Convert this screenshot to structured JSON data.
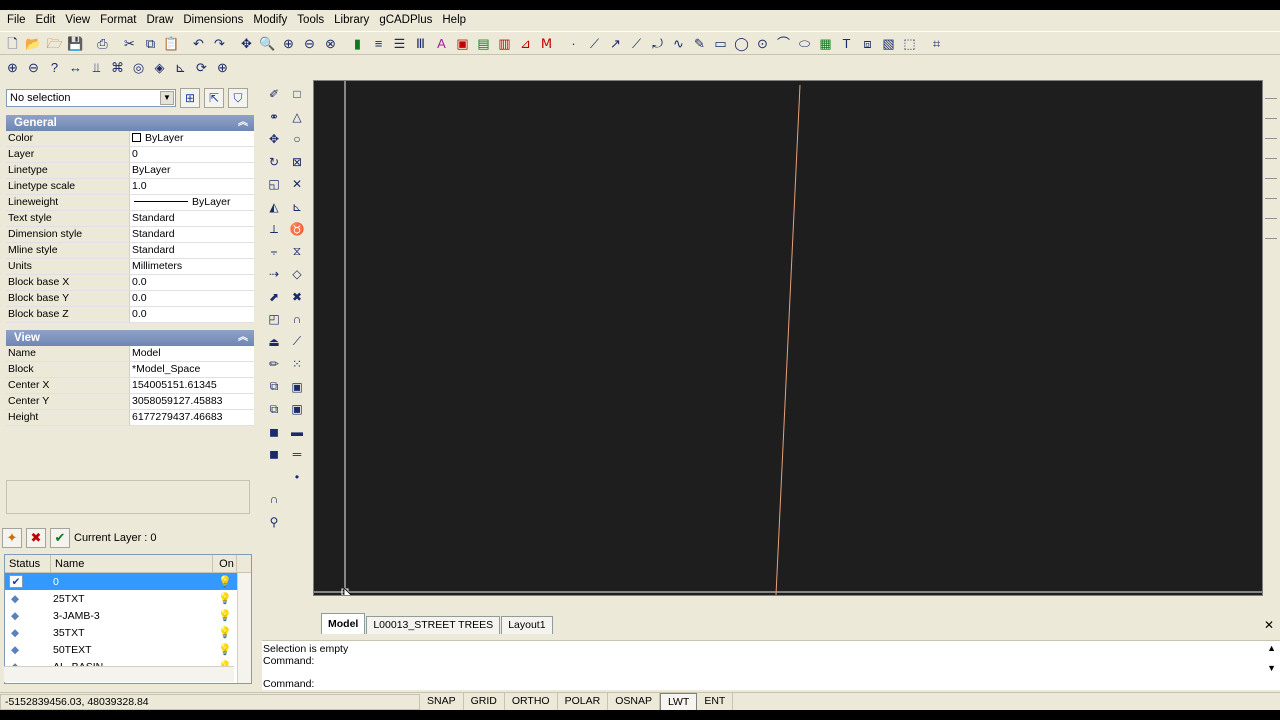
{
  "menu": [
    "File",
    "Edit",
    "View",
    "Format",
    "Draw",
    "Dimensions",
    "Modify",
    "Tools",
    "Library",
    "gCADPlus",
    "Help"
  ],
  "selection": {
    "value": "No selection"
  },
  "general": {
    "title": "General",
    "rows": [
      {
        "name": "Color",
        "value": "ByLayer"
      },
      {
        "name": "Layer",
        "value": "0"
      },
      {
        "name": "Linetype",
        "value": "ByLayer"
      },
      {
        "name": "Linetype scale",
        "value": "1.0"
      },
      {
        "name": "Lineweight",
        "value": "ByLayer"
      },
      {
        "name": "Text style",
        "value": "Standard"
      },
      {
        "name": "Dimension style",
        "value": "Standard"
      },
      {
        "name": "Mline style",
        "value": "Standard"
      },
      {
        "name": "Units",
        "value": "Millimeters"
      },
      {
        "name": "Block base X",
        "value": "0.0"
      },
      {
        "name": "Block base Y",
        "value": "0.0"
      },
      {
        "name": "Block base Z",
        "value": "0.0"
      }
    ]
  },
  "view": {
    "title": "View",
    "rows": [
      {
        "name": "Name",
        "value": "Model"
      },
      {
        "name": "Block",
        "value": "*Model_Space"
      },
      {
        "name": "Center X",
        "value": "154005151.61345"
      },
      {
        "name": "Center Y",
        "value": "3058059127.45883"
      },
      {
        "name": "Height",
        "value": "6177279437.46683"
      }
    ]
  },
  "layers": {
    "current_label": "Current Layer : 0",
    "headers": {
      "status": "Status",
      "name": "Name",
      "on": "On"
    },
    "rows": [
      {
        "status": "✔",
        "name": "0",
        "selected": true
      },
      {
        "status": "◆",
        "name": "25TXT"
      },
      {
        "status": "◆",
        "name": "3-JAMB-3"
      },
      {
        "status": "◆",
        "name": "35TXT"
      },
      {
        "status": "◆",
        "name": "50TEXT"
      },
      {
        "status": "◆",
        "name": "AL_BASIN"
      }
    ]
  },
  "tabs": [
    "Model",
    "L00013_STREET TREES",
    "Layout1"
  ],
  "command": {
    "line1": "Selection is empty",
    "line2": "Command:",
    "prompt": "Command:"
  },
  "status": {
    "coords": "-5152839456.03,  48039328.84",
    "buttons": [
      {
        "label": "SNAP",
        "on": false
      },
      {
        "label": "GRID",
        "on": false
      },
      {
        "label": "ORTHO",
        "on": false
      },
      {
        "label": "POLAR",
        "on": false
      },
      {
        "label": "OSNAP",
        "on": false
      },
      {
        "label": "LWT",
        "on": true
      },
      {
        "label": "ENT",
        "on": false
      }
    ]
  },
  "colors": {
    "canvas_bg": "#1e1e1e",
    "drawn_line": "#e8a07a",
    "accent": "#3399ff"
  }
}
